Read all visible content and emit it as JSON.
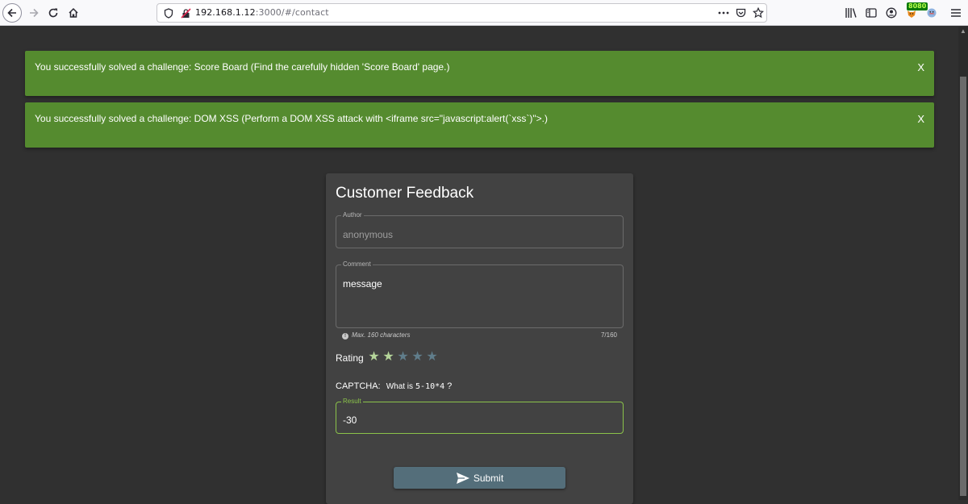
{
  "browser": {
    "url_host": "192.168.1.12",
    "url_rest": ":3000/#/contact",
    "proxy_badge": "8080",
    "icons": [
      "back-icon",
      "forward-icon",
      "reload-icon",
      "home-icon",
      "shield-icon",
      "insecure-lock-icon",
      "more-icon",
      "pocket-icon",
      "bookmark-star-icon",
      "library-icon",
      "sidebar-icon",
      "account-icon",
      "foxyproxy-icon",
      "extension-icon",
      "menu-icon"
    ]
  },
  "toasts": [
    {
      "message": "You successfully solved a challenge: Score Board (Find the carefully hidden 'Score Board' page.)",
      "close": "X"
    },
    {
      "message": "You successfully solved a challenge: DOM XSS (Perform a DOM XSS attack with <iframe src=\"javascript:alert(`xss`)\">.)",
      "close": "X"
    }
  ],
  "feedback": {
    "title": "Customer Feedback",
    "author_label": "Author",
    "author_value": "anonymous",
    "comment_label": "Comment",
    "comment_value": "message",
    "hint": "Max. 160 characters",
    "char_count": "7/160",
    "rating_label": "Rating",
    "rating_value": 2,
    "rating_max": 5,
    "captcha_label": "CAPTCHA:",
    "captcha_prefix": "What is",
    "captcha_expr": "5-10*4",
    "captcha_suffix": "?",
    "result_label": "Result",
    "result_value": "-30",
    "submit_label": "Submit"
  },
  "colors": {
    "toast_bg": "#558b2f",
    "card_bg": "#424242",
    "star_on": "#b5d59a",
    "star_off": "#607d8b",
    "submit_bg": "#546e7a",
    "focus_border": "#8bc34a"
  }
}
